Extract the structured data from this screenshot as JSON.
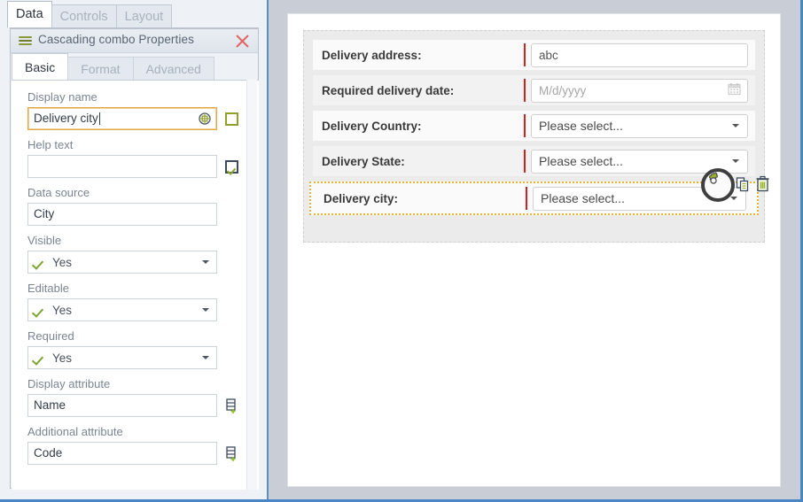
{
  "window": {
    "top_tabs": [
      {
        "label": "Data",
        "active": true
      },
      {
        "label": "Controls",
        "active": false
      },
      {
        "label": "Layout",
        "active": false
      }
    ]
  },
  "properties_dialog": {
    "title": "Cascading combo Properties",
    "title_icon": "list-lines-icon",
    "close_icon": "close-icon",
    "tabs": [
      {
        "label": "Basic",
        "active": true
      },
      {
        "label": "Format",
        "active": false
      },
      {
        "label": "Advanced",
        "active": false
      }
    ],
    "fields": [
      {
        "label": "Display name",
        "type": "text",
        "value": "Delivery city",
        "focused": true,
        "in_field_icon": "globe-icon",
        "side_control": "checkbox-unchecked"
      },
      {
        "label": "Help text",
        "type": "text",
        "value": "",
        "focused": false,
        "side_control": "checkbox-checked"
      },
      {
        "label": "Data source",
        "type": "text",
        "value": "City",
        "focused": false,
        "side_control": "none"
      },
      {
        "label": "Visible",
        "type": "combo",
        "value": "Yes",
        "side_control": "none"
      },
      {
        "label": "Editable",
        "type": "combo",
        "value": "Yes",
        "side_control": "none"
      },
      {
        "label": "Required",
        "type": "combo",
        "value": "Yes",
        "side_control": "none"
      },
      {
        "label": "Display attribute",
        "type": "text",
        "value": "Name",
        "focused": false,
        "side_control": "database-add-icon"
      },
      {
        "label": "Additional attribute",
        "type": "text",
        "value": "Code",
        "focused": false,
        "side_control": "database-add-icon"
      }
    ]
  },
  "designer": {
    "rows": [
      {
        "label": "Delivery address:",
        "control": "text",
        "value": "abc",
        "placeholder": "",
        "required": true,
        "selected": false
      },
      {
        "label": "Required delivery date:",
        "control": "date",
        "value": "",
        "placeholder": "M/d/yyyy",
        "required": true,
        "selected": false
      },
      {
        "label": "Delivery Country:",
        "control": "dropdown",
        "value": "Please select...",
        "placeholder": "Please select...",
        "required": true,
        "selected": false
      },
      {
        "label": "Delivery State:",
        "control": "dropdown",
        "value": "Please select...",
        "placeholder": "Please select...",
        "required": true,
        "selected": false
      },
      {
        "label": "Delivery city:",
        "control": "dropdown",
        "value": "Please select...",
        "placeholder": "Please select...",
        "required": true,
        "selected": true
      }
    ],
    "row_actions": [
      {
        "name": "settings-gear-icon",
        "label": "Settings"
      },
      {
        "name": "copy-icon",
        "label": "Copy"
      },
      {
        "name": "delete-trash-icon",
        "label": "Delete"
      }
    ]
  },
  "colors": {
    "accent_blue": "#4a85c4",
    "selection_orange": "#e8b530",
    "focus_orange": "#e0a94a",
    "required_red": "#d81f1f",
    "olive_green": "#8fa02e",
    "check_green": "#7ba62f"
  }
}
